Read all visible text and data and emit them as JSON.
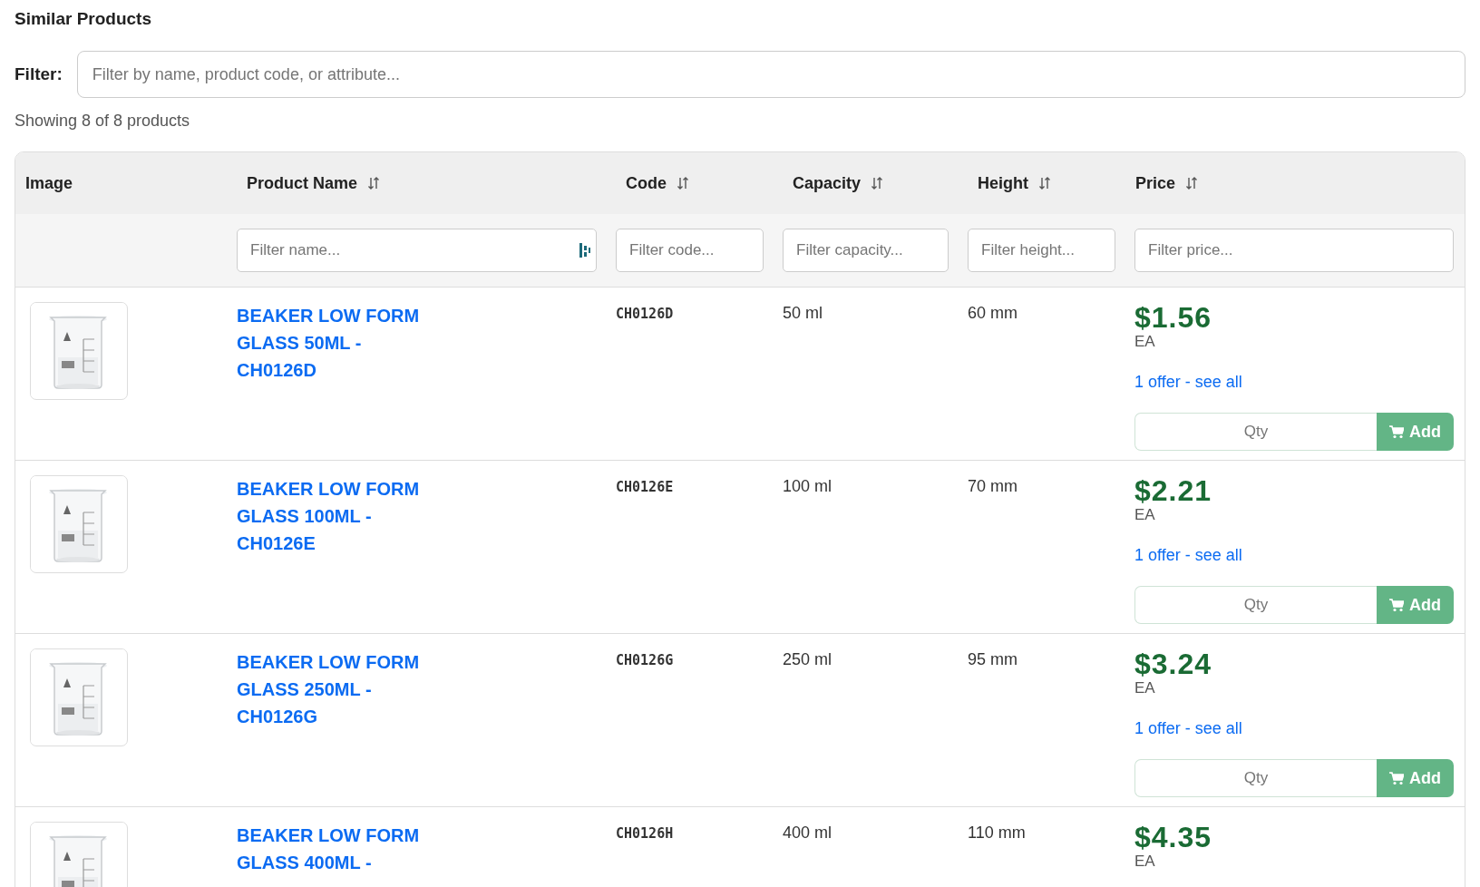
{
  "title": "Similar Products",
  "filter": {
    "label": "Filter:",
    "placeholder": "Filter by name, product code, or attribute..."
  },
  "count_text": "Showing 8 of 8 products",
  "table": {
    "columns": [
      {
        "label": "Image",
        "sortable": false
      },
      {
        "label": "Product Name",
        "sortable": true
      },
      {
        "label": "Code",
        "sortable": true
      },
      {
        "label": "Capacity",
        "sortable": true
      },
      {
        "label": "Height",
        "sortable": true
      },
      {
        "label": "Price",
        "sortable": true
      }
    ],
    "column_filters": [
      {
        "placeholder": "Filter name..."
      },
      {
        "placeholder": "Filter code..."
      },
      {
        "placeholder": "Filter capacity..."
      },
      {
        "placeholder": "Filter height..."
      },
      {
        "placeholder": "Filter price..."
      }
    ],
    "rows": [
      {
        "name": "BEAKER LOW FORM GLASS 50ML - CH0126D",
        "code": "CH0126D",
        "capacity": "50 ml",
        "height": "60 mm",
        "price": "$1.56",
        "unit": "EA",
        "offers": "1 offer - see all",
        "qty_placeholder": "Qty",
        "add_label": "Add"
      },
      {
        "name": "BEAKER LOW FORM GLASS 100ML - CH0126E",
        "code": "CH0126E",
        "capacity": "100 ml",
        "height": "70 mm",
        "price": "$2.21",
        "unit": "EA",
        "offers": "1 offer - see all",
        "qty_placeholder": "Qty",
        "add_label": "Add"
      },
      {
        "name": "BEAKER LOW FORM GLASS 250ML - CH0126G",
        "code": "CH0126G",
        "capacity": "250 ml",
        "height": "95 mm",
        "price": "$3.24",
        "unit": "EA",
        "offers": "1 offer - see all",
        "qty_placeholder": "Qty",
        "add_label": "Add"
      },
      {
        "name": "BEAKER LOW FORM GLASS 400ML -",
        "code": "CH0126H",
        "capacity": "400 ml",
        "height": "110 mm",
        "price": "$4.35",
        "unit": "EA"
      }
    ]
  }
}
